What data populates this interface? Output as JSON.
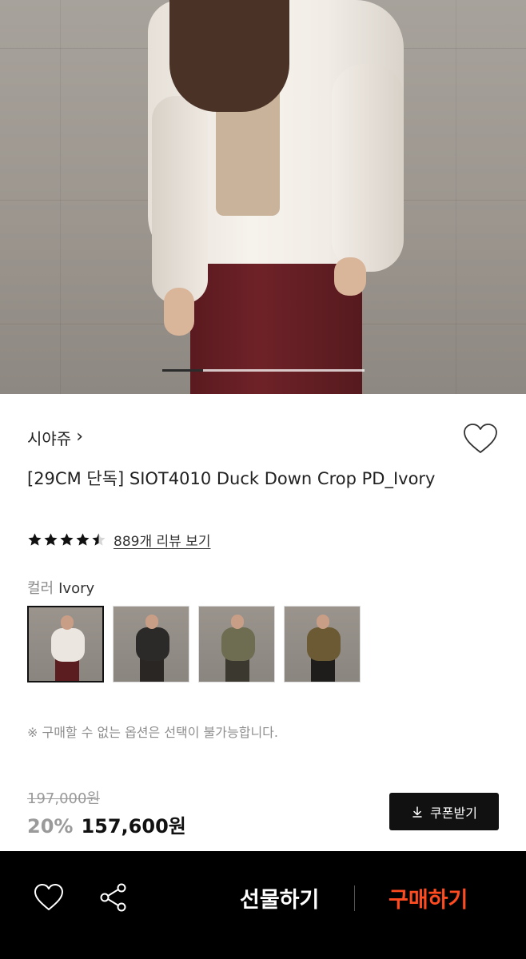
{
  "hero": {
    "image_description": "model-photo",
    "slide_progress": 0.2
  },
  "product": {
    "brand": "시야쥬",
    "brand_chevron": "›",
    "title": "[29CM 단독] SIOT4010 Duck Down Crop PD_Ivory",
    "rating": 4.5,
    "review_link": "889개 리뷰 보기"
  },
  "options": {
    "color_label": "컬러",
    "color_value": "Ivory",
    "swatches": [
      {
        "name": "Ivory",
        "color": "#ebe6df",
        "legs": "#5c1d21"
      },
      {
        "name": "Black",
        "color": "#2c2a28",
        "legs": "#2a2623"
      },
      {
        "name": "Khaki",
        "color": "#6e6d52",
        "legs": "#3b392f"
      },
      {
        "name": "Brown",
        "color": "#6b5a33",
        "legs": "#1f1c1c"
      }
    ],
    "notice": "※ 구매할 수 없는 옵션은 선택이 불가능합니다."
  },
  "pricing": {
    "original_price": "197,000원",
    "discount": "20%",
    "price": "157,600원",
    "coupon_label": "쿠폰받기"
  },
  "bottom_bar": {
    "gift_label": "선물하기",
    "buy_label": "구매하기"
  },
  "colors": {
    "accent": "#ff4b1f",
    "bottom_bar_bg": "#000000"
  }
}
